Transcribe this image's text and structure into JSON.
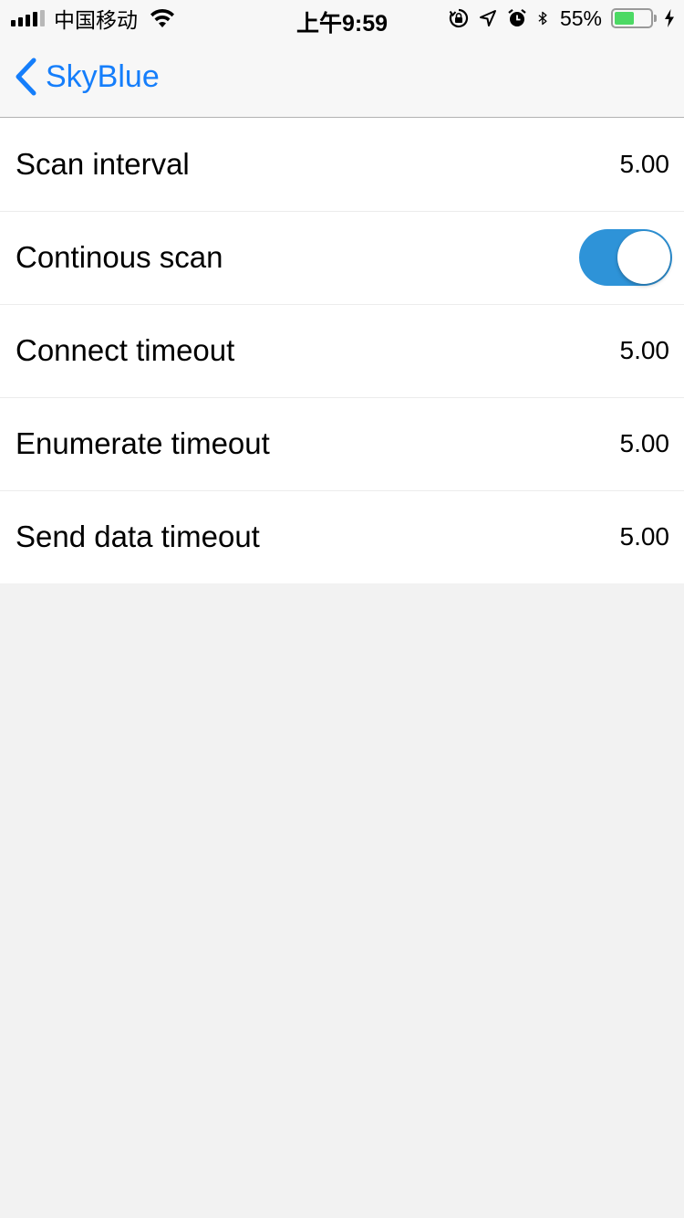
{
  "status_bar": {
    "carrier": "中国移动",
    "time": "上午9:59",
    "battery_percent": "55%",
    "battery_level": 0.55,
    "icons": [
      "signal-icon",
      "wifi-icon",
      "orientation-lock-icon",
      "location-icon",
      "alarm-icon",
      "bluetooth-icon",
      "battery-icon",
      "charging-icon"
    ]
  },
  "nav": {
    "back_label": "SkyBlue",
    "back_icon": "chevron-left-icon",
    "accent_color": "#157efb"
  },
  "settings": {
    "rows": [
      {
        "label": "Scan interval",
        "value": "5.00"
      },
      {
        "label": "Continous scan",
        "toggle_on": true
      },
      {
        "label": "Connect timeout",
        "value": "5.00"
      },
      {
        "label": "Enumerate timeout",
        "value": "5.00"
      },
      {
        "label": "Send data timeout",
        "value": "5.00"
      }
    ],
    "toggle_color": "#2e93d8"
  }
}
